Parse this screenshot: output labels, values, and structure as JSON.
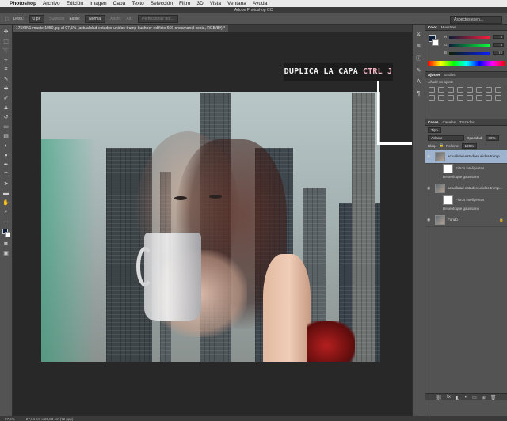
{
  "menubar": {
    "apple": "",
    "app": "Photoshop",
    "items": [
      "Archivo",
      "Edición",
      "Imagen",
      "Capa",
      "Texto",
      "Selección",
      "Filtro",
      "3D",
      "Vista",
      "Ventana",
      "Ayuda"
    ]
  },
  "window": {
    "title": "Adobe Photoshop CC"
  },
  "options": {
    "desv_label": "Desv.:",
    "desv_value": "0 px",
    "suavizar": "Suavizar",
    "estilo_label": "Estilo:",
    "estilo_value": "Normal",
    "anch": "Anch.:",
    "alt": "Alt.:",
    "perfeccionar": "Perfeccionar bor...",
    "workspace": "Aspectos esen..."
  },
  "document": {
    "tab": "175KIN1-master1050.jpg al 97,5% (actualidad-estados-unidos-trump-kushner-edificio-666-sheamanol copia, RGB/8#) *"
  },
  "callout": {
    "text": "DUPLICA LA CAPA",
    "shortcut": "CTRL J"
  },
  "panels": {
    "color_tabs": [
      "Color",
      "Muestras"
    ],
    "sliders": [
      {
        "label": "R",
        "value": "0"
      },
      {
        "label": "G",
        "value": "0"
      },
      {
        "label": "B",
        "value": "72"
      }
    ],
    "adj_tabs": [
      "Ajustes",
      "Estilos"
    ],
    "adj_title": "Añadir un ajuste",
    "layers_tabs": [
      "Capas",
      "Canales",
      "Trazados"
    ],
    "kind": "Tipo",
    "blend": "Aclarar",
    "opacity_label": "Opacidad:",
    "opacity": "80%",
    "lock_label": "Bloq.:",
    "fill_label": "Relleno:",
    "fill": "100%",
    "layers": [
      {
        "name": "actualidad-estados-unidos-trump...",
        "active": true
      },
      {
        "name": "Filtros inteligentes",
        "sub": true
      },
      {
        "name": "Desenfoque gaussiano",
        "fx": true
      },
      {
        "name": "actualidad-estados-unidos-trump...",
        "active": false
      },
      {
        "name": "Filtros inteligentes",
        "sub": true
      },
      {
        "name": "Desenfoque gaussiano",
        "fx": true
      },
      {
        "name": "Fondo",
        "active": false
      }
    ]
  },
  "status": {
    "zoom": "97,5%",
    "doc": "27,94 cm x 20,83 cm (72 ppp)"
  },
  "colors": {
    "accent": "#9db3cf",
    "foreground": "#0b1f3a",
    "callout_highlight": "#f2b6c3"
  }
}
